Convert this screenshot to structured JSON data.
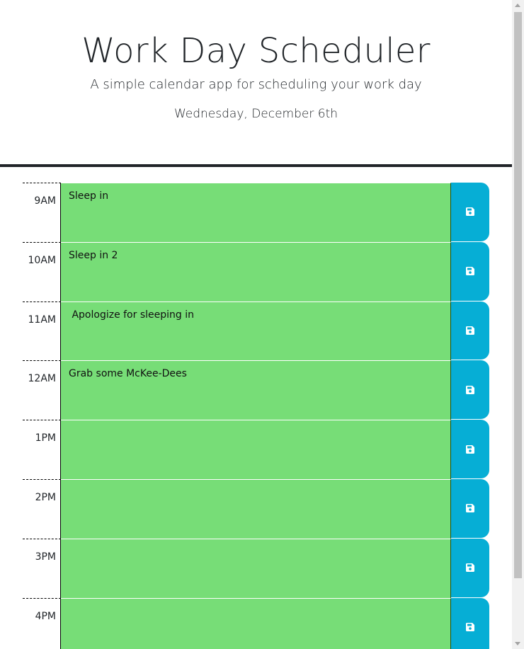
{
  "header": {
    "title": "Work Day Scheduler",
    "lead": "A simple calendar app for scheduling your work day",
    "current_day": "Wednesday, December 6th"
  },
  "colors": {
    "present_future_block": "#77dd77",
    "save_button": "#06aed5",
    "header_border": "#212529"
  },
  "save_icon": "floppy-disk-icon",
  "time_blocks": [
    {
      "hour": "9AM",
      "text": "Sleep in"
    },
    {
      "hour": "10AM",
      "text": "Sleep in 2"
    },
    {
      "hour": "11AM",
      "text": " Apologize for sleeping in"
    },
    {
      "hour": "12AM",
      "text": "Grab some McKee-Dees"
    },
    {
      "hour": "1PM",
      "text": ""
    },
    {
      "hour": "2PM",
      "text": ""
    },
    {
      "hour": "3PM",
      "text": ""
    },
    {
      "hour": "4PM",
      "text": ""
    }
  ]
}
